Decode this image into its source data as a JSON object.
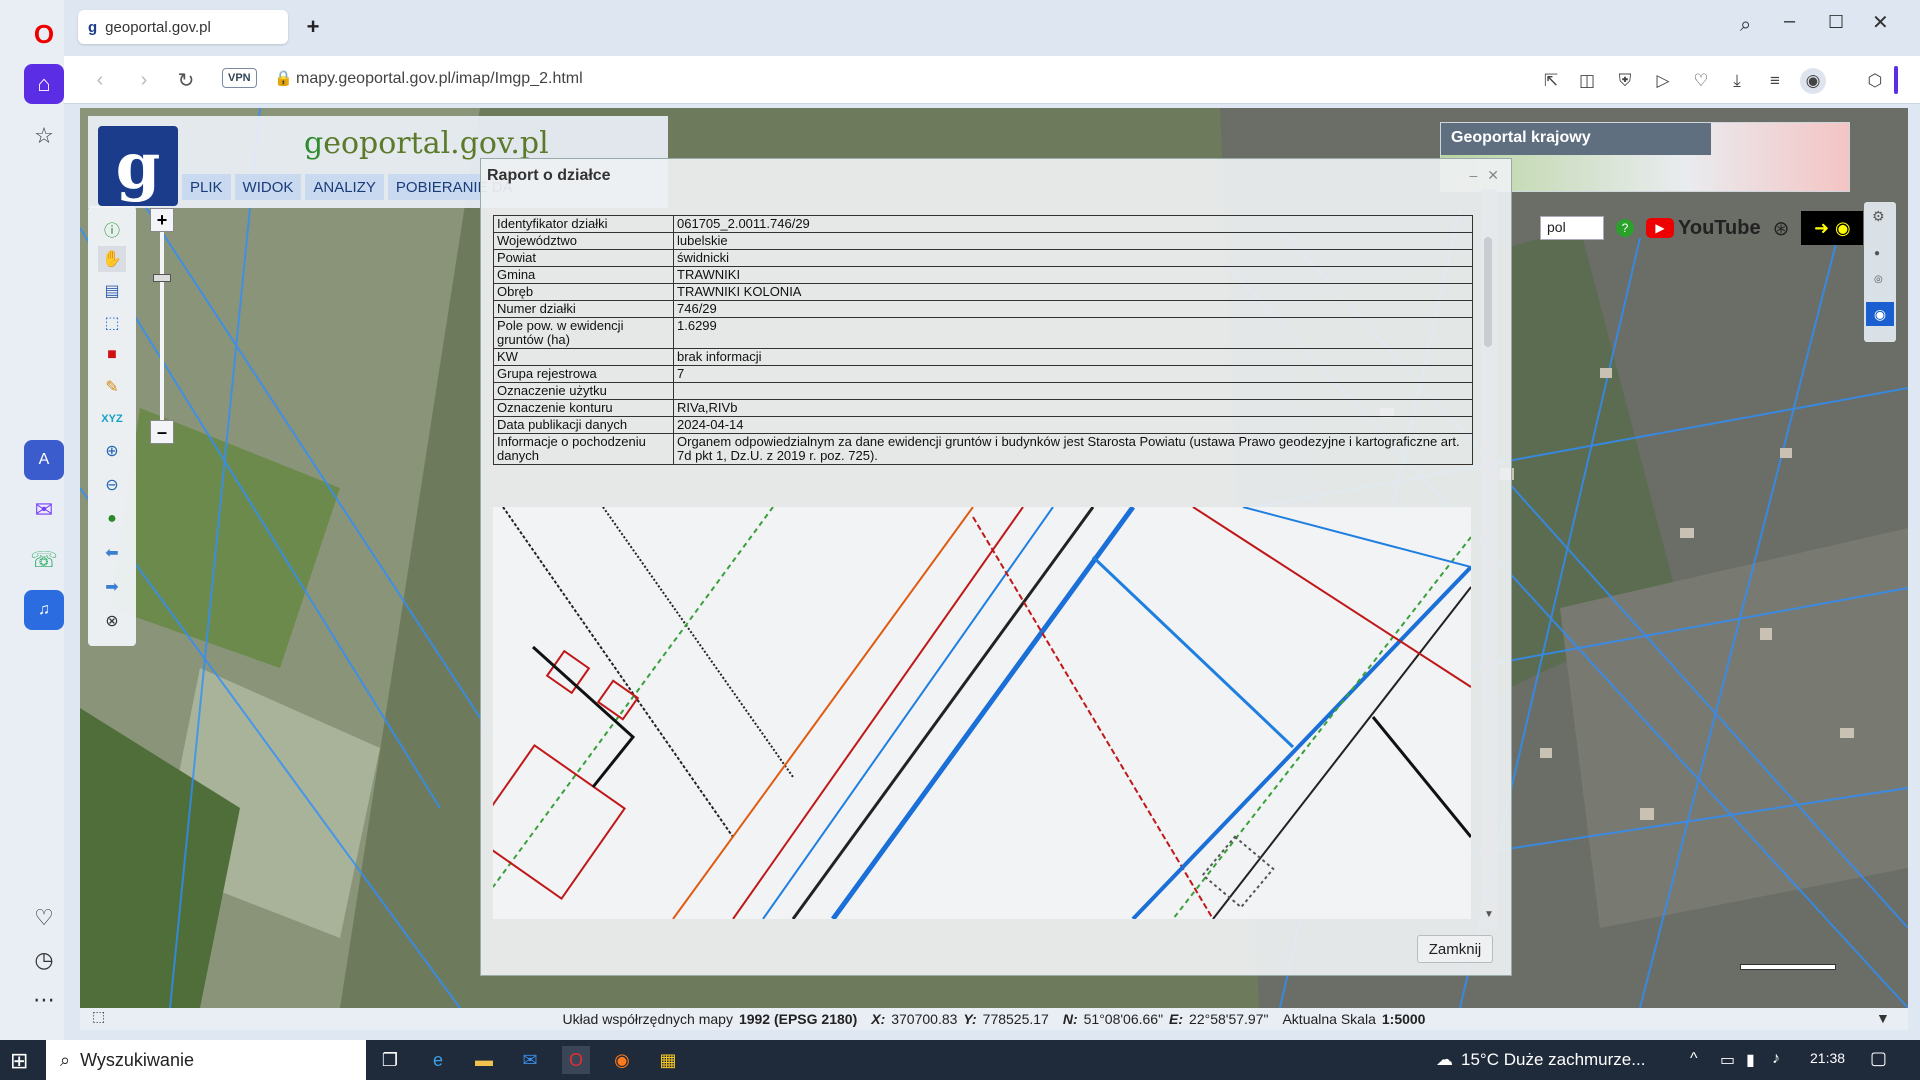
{
  "browser": {
    "tab_title": "geoportal.gov.pl",
    "new_tab": "+",
    "vpn_label": "VPN",
    "url": "mapy.geoportal.gov.pl/imap/Imgp_2.html"
  },
  "site": {
    "logo_letter": "g",
    "name_prefix": "g",
    "name_rest": "eoportal.gov.pl",
    "menu": [
      "PLIK",
      "WIDOK",
      "ANALIZY",
      "POBIERANIE DA"
    ],
    "geoportal_krajowy": "Geoportal krajowy",
    "language": "pol",
    "youtube": "YouTube"
  },
  "dialog": {
    "title": "Raport o działce",
    "close_label": "Zamknij",
    "rows": [
      {
        "key": "Identyfikator działki",
        "value": "061705_2.0011.746/29"
      },
      {
        "key": "Województwo",
        "value": "lubelskie"
      },
      {
        "key": "Powiat",
        "value": "świdnicki"
      },
      {
        "key": "Gmina",
        "value": "TRAWNIKI"
      },
      {
        "key": "Obręb",
        "value": "TRAWNIKI KOLONIA"
      },
      {
        "key": "Numer działki",
        "value": "746/29"
      },
      {
        "key": "Pole pow. w ewidencji gruntów (ha)",
        "value": "1.6299"
      },
      {
        "key": "KW",
        "value": "brak informacji"
      },
      {
        "key": "Grupa rejestrowa",
        "value": "7"
      },
      {
        "key": "Oznaczenie użytku",
        "value": ""
      },
      {
        "key": "Oznaczenie konturu",
        "value": "RIVa,RIVb"
      },
      {
        "key": "Data publikacji danych",
        "value": "2024-04-14"
      },
      {
        "key": "Informacje o pochodzeniu danych",
        "value": "Organem odpowiedzialnym za dane ewidencji gruntów i budynków jest Starosta Powiatu (ustawa Prawo geodezyjne i kartograficzne art. 7d pkt 1, Dz.U. z 2019 r. poz. 725)."
      }
    ]
  },
  "status": {
    "coord_label": "Układ współrzędnych mapy",
    "coord_system": "1992 (EPSG 2180)",
    "x_label": "X:",
    "x": "370700.83",
    "y_label": "Y:",
    "y": "778525.17",
    "n_label": "N:",
    "n": "51°08'06.66\"",
    "e_label": "E:",
    "e": "22°58'57.97\"",
    "scale_label": "Aktualna Skala",
    "scale": "1:5000"
  },
  "taskbar": {
    "search_placeholder": "Wyszukiwanie",
    "weather": "15°C  Duże zachmurze...",
    "time": "21:38"
  }
}
